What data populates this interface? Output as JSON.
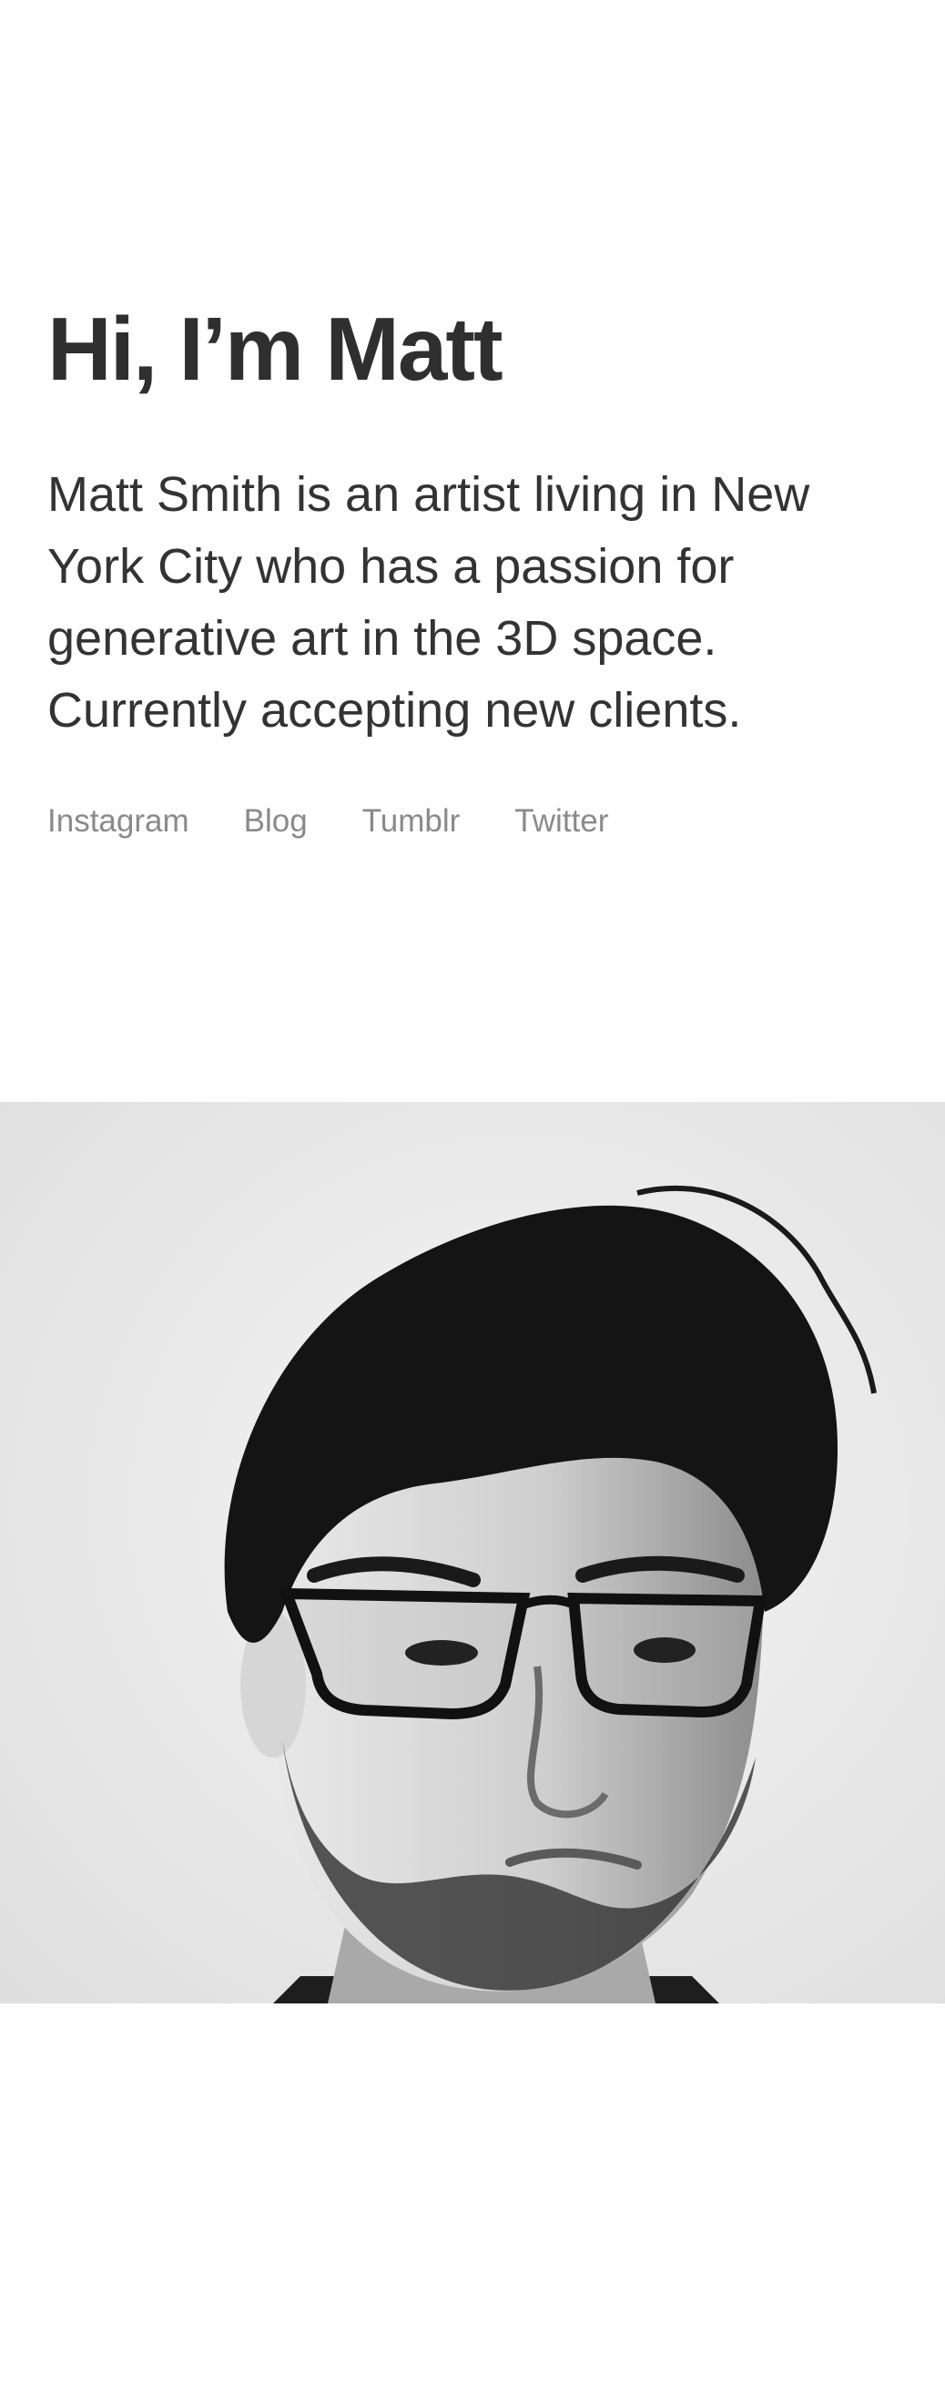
{
  "hero": {
    "heading": "Hi, I’m Matt",
    "bio": "Matt Smith is an artist living in New York City who has a passion for generative art in the 3D space. Currently accepting new clients."
  },
  "social_links": [
    {
      "label": "Instagram"
    },
    {
      "label": "Blog"
    },
    {
      "label": "Tumblr"
    },
    {
      "label": "Twitter"
    }
  ],
  "portrait": {
    "description_icon": "portrait-photo",
    "tone": "black-and-white"
  }
}
